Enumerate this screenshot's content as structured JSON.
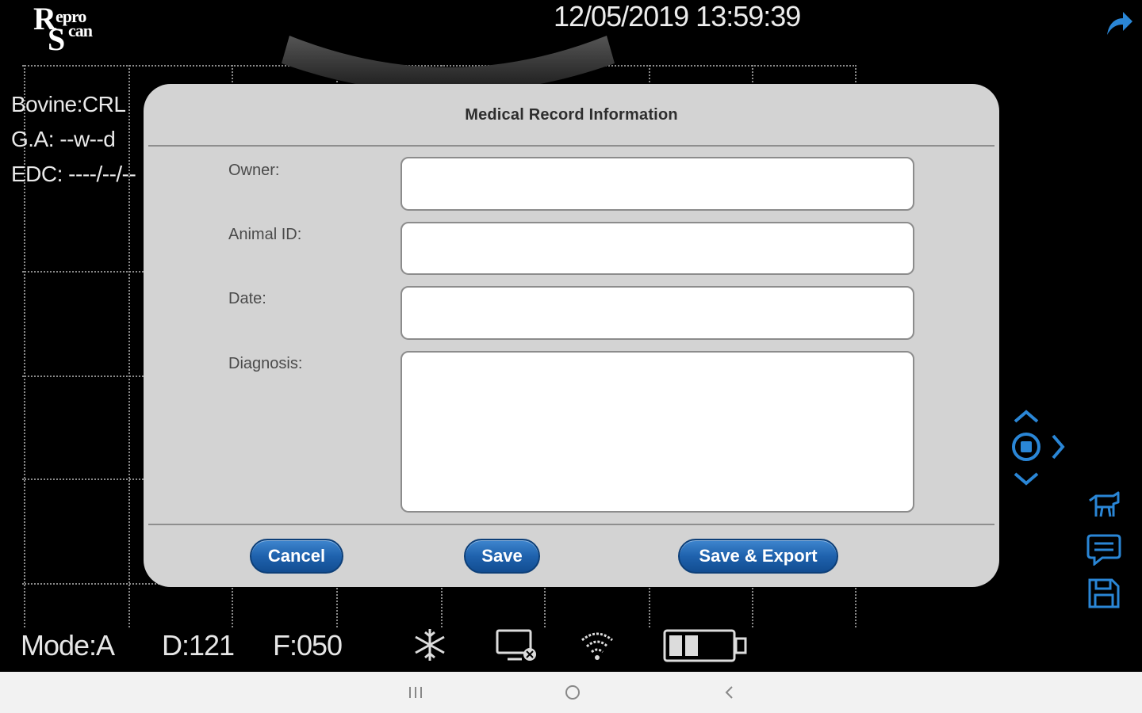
{
  "header": {
    "logo_line1": "R",
    "logo_text1": "epro",
    "logo_line2": "S",
    "logo_text2": "can",
    "datetime": "12/05/2019  13:59:39",
    "share_icon": "share-arrow-icon"
  },
  "info": {
    "species": "Bovine:CRL",
    "ga": "G.A: --w--d",
    "edc": "EDC: ----/--/--"
  },
  "status_bar": {
    "mode": "Mode:A",
    "depth": "D:121",
    "frequency": "F:050",
    "icons": [
      "freeze-snowflake-icon",
      "display-disconnected-icon",
      "wifi-icon",
      "battery-icon"
    ]
  },
  "side_controls": {
    "icons": [
      "dpad-up-icon",
      "dpad-center-icon",
      "dpad-right-icon",
      "dpad-down-icon",
      "animal-icon",
      "comment-icon",
      "save-disk-icon"
    ],
    "accent_color": "#2a86d6"
  },
  "dialog": {
    "title": "Medical Record Information",
    "fields": {
      "owner_label": "Owner:",
      "owner_value": "",
      "animal_id_label": "Animal ID:",
      "animal_id_value": "",
      "date_label": "Date:",
      "date_value": "",
      "diagnosis_label": "Diagnosis:",
      "diagnosis_value": ""
    },
    "buttons": {
      "cancel": "Cancel",
      "save": "Save",
      "save_export": "Save & Export"
    }
  },
  "android_nav": {
    "icons": [
      "recent-apps-icon",
      "home-icon",
      "back-icon"
    ]
  }
}
